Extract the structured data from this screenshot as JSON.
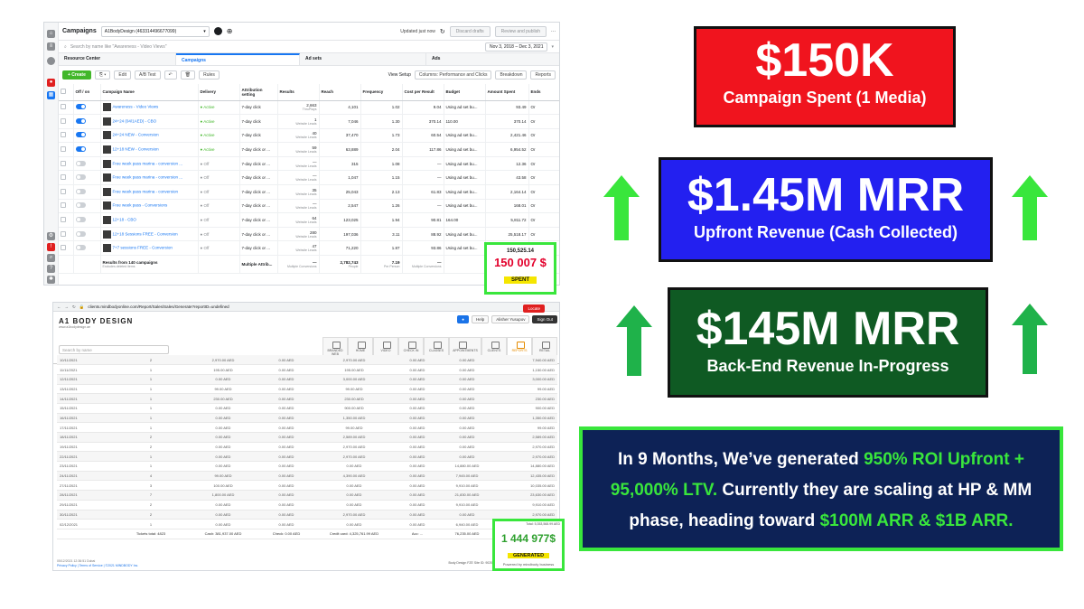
{
  "fb": {
    "title": "Campaigns",
    "account": "A1BodyDesign (463314496677099)",
    "updated": "Updated just now",
    "discard": "Discard drafts",
    "review": "Review and publish",
    "search_placeholder": "Search by name like \"Awareness - Video Views\"",
    "date_range": "Nov 3, 2018 – Dec 3, 2021",
    "tabs": [
      "Resource Center",
      "Campaigns",
      "Ad sets",
      "Ads"
    ],
    "create": "+ Create",
    "edit": "Edit",
    "abtest": "A/B Test",
    "rules": "Rules",
    "view_setup": "View Setup",
    "columns": "Columns: Performance and Clicks",
    "breakdown": "Breakdown",
    "reports": "Reports",
    "headers": [
      "Off / on",
      "Campaign Name",
      "Delivery",
      "Attribution setting",
      "Results",
      "Reach",
      "Frequency",
      "Cost per Result",
      "Budget",
      "Amount Spent",
      "Ends"
    ],
    "rows": [
      {
        "on": true,
        "name": "Awareness - Video Views",
        "delivery": "Active",
        "attr": "7-day click",
        "results": "2,663",
        "rsub": "ThruPlays",
        "reach": "4,101",
        "freq": "1.02",
        "cpr": "9.04",
        "budget": "Using ad set bu...",
        "spent": "93.49",
        "ends": "Or"
      },
      {
        "on": true,
        "name": "24+24 (04/1AED) - CBO",
        "delivery": "Active",
        "attr": "7-day click",
        "results": "1",
        "rsub": "Website Leads",
        "reach": "7,046",
        "freq": "1.30",
        "cpr": "370.14",
        "budget": "110.00",
        "spent": "370.14",
        "ends": "Or"
      },
      {
        "on": true,
        "name": "24+24 NEW - Conversion",
        "delivery": "Active",
        "attr": "7-day click",
        "results": "40",
        "rsub": "Website Leads",
        "reach": "37,470",
        "freq": "1.73",
        "cpr": "60.54",
        "budget": "Using ad set bu...",
        "spent": "2,421.46",
        "ends": "Or"
      },
      {
        "on": true,
        "name": "12+18 NEW - Conversion",
        "delivery": "Active",
        "attr": "7-day click or ...",
        "results": "59",
        "rsub": "Website Leads",
        "reach": "63,889",
        "freq": "2.04",
        "cpr": "117.86",
        "budget": "Using ad set bu...",
        "spent": "6,954.52",
        "ends": "Or"
      },
      {
        "on": false,
        "name": "Free week pass marina - conversion ...",
        "delivery": "Off",
        "attr": "7-day click or ...",
        "results": "—",
        "rsub": "Website Leads",
        "reach": "315",
        "freq": "1.08",
        "cpr": "—",
        "budget": "Using ad set bu...",
        "spent": "12.36",
        "ends": "Or"
      },
      {
        "on": false,
        "name": "Free week pass marina - conversion ...",
        "delivery": "Off",
        "attr": "7-day click or ...",
        "results": "—",
        "rsub": "Website Leads",
        "reach": "1,047",
        "freq": "1.15",
        "cpr": "—",
        "budget": "Using ad set bu...",
        "spent": "43.58",
        "ends": "Or"
      },
      {
        "on": false,
        "name": "Free week pass marina - conversion",
        "delivery": "Off",
        "attr": "7-day click or ...",
        "results": "35",
        "rsub": "Website Leads",
        "reach": "25,043",
        "freq": "2.13",
        "cpr": "61.83",
        "budget": "Using ad set bu...",
        "spent": "2,164.14",
        "ends": "Or"
      },
      {
        "on": false,
        "name": "Free week pass - Conversions",
        "delivery": "Off",
        "attr": "7-day click or ...",
        "results": "—",
        "rsub": "Website Leads",
        "reach": "2,547",
        "freq": "1.26",
        "cpr": "—",
        "budget": "Using ad set bu...",
        "spent": "168.01",
        "ends": "Or"
      },
      {
        "on": false,
        "name": "12+18 - CBO",
        "delivery": "Off",
        "attr": "7-day click or ...",
        "results": "64",
        "rsub": "Website Leads",
        "reach": "123,025",
        "freq": "1.94",
        "cpr": "90.81",
        "budget": "164.00",
        "spent": "5,811.72",
        "ends": "Or"
      },
      {
        "on": false,
        "name": "12+18 Sessions FREE - Conversion",
        "delivery": "Off",
        "attr": "7-day click or ...",
        "results": "280",
        "rsub": "Website Leads",
        "reach": "197,036",
        "freq": "3.11",
        "cpr": "88.92",
        "budget": "Using ad set bu...",
        "spent": "25,518.17",
        "ends": "Or"
      },
      {
        "on": false,
        "name": "7+7 sessions FREE - Conversion",
        "delivery": "Off",
        "attr": "7-day click or ...",
        "results": "47",
        "rsub": "Website Leads",
        "reach": "71,220",
        "freq": "1.87",
        "cpr": "93.86",
        "budget": "Using ad set bu...",
        "spent": "4,412.16",
        "ends": "Or"
      }
    ],
    "total": {
      "name": "Results from 140 campaigns",
      "sub": "Excludes deleted items",
      "attr": "Multiple Attrib...",
      "results": "—",
      "rsub": "Multiple Conversions",
      "reach": "2,782,743",
      "reachsub": "People",
      "freq": "7.19",
      "freqsub": "Per Person",
      "cpr": "—",
      "cprsub": "Multiple Conversions",
      "spent": "150,525.14"
    },
    "spent_label": "150 007 $",
    "spent_tag": "SPENT"
  },
  "mb": {
    "url": "clients.mindbodyonline.com/Report/Sales/Sales/Generate?reportID=undefined",
    "brand": "A1 BODY DESIGN",
    "brand_sub": "www.a1bodydesign.ae",
    "help": "Help",
    "user": "Alisher Yusupov",
    "signout": "Sign Out",
    "locate": "Locate",
    "search_placeholder": "Search by name",
    "nav": [
      "BRANDED WEB",
      "HOME",
      "VIDEO",
      "CHECK IN",
      "CLASSES",
      "APPOINTMENTS",
      "CLIENTS",
      "REPORTS",
      "RETAIL"
    ],
    "rows": [
      [
        "10/11/2021",
        "2",
        "2,970.00 AED",
        "0.00 AED",
        "2,970.00 AED",
        "0.00 AED",
        "0.00 AED",
        "7,940.00 AED"
      ],
      [
        "11/11/2021",
        "1",
        "195.00 AED",
        "0.00 AED",
        "195.00 AED",
        "0.00 AED",
        "0.00 AED",
        "1,150.00 AED"
      ],
      [
        "12/11/2021",
        "1",
        "0.00 AED",
        "0.00 AED",
        "3,000.00 AED",
        "0.00 AED",
        "0.00 AED",
        "3,000.00 AED"
      ],
      [
        "13/11/2021",
        "1",
        "99.00 AED",
        "0.00 AED",
        "99.00 AED",
        "0.00 AED",
        "0.00 AED",
        "99.00 AED"
      ],
      [
        "14/11/2021",
        "1",
        "230.00 AED",
        "0.00 AED",
        "230.00 AED",
        "0.00 AED",
        "0.00 AED",
        "230.00 AED"
      ],
      [
        "15/11/2021",
        "1",
        "0.00 AED",
        "0.00 AED",
        "900.00 AED",
        "0.00 AED",
        "0.00 AED",
        "900.00 AED"
      ],
      [
        "16/11/2021",
        "1",
        "0.00 AED",
        "0.00 AED",
        "1,350.00 AED",
        "0.00 AED",
        "0.00 AED",
        "1,350.00 AED"
      ],
      [
        "17/11/2021",
        "1",
        "0.00 AED",
        "0.00 AED",
        "99.00 AED",
        "0.00 AED",
        "0.00 AED",
        "99.00 AED"
      ],
      [
        "18/11/2021",
        "2",
        "0.00 AED",
        "0.00 AED",
        "2,589.00 AED",
        "0.00 AED",
        "0.00 AED",
        "2,589.00 AED"
      ],
      [
        "19/11/2021",
        "2",
        "0.00 AED",
        "0.00 AED",
        "2,970.00 AED",
        "0.00 AED",
        "0.00 AED",
        "2,970.00 AED"
      ],
      [
        "22/11/2021",
        "1",
        "0.00 AED",
        "0.00 AED",
        "2,970.00 AED",
        "0.00 AED",
        "0.00 AED",
        "2,970.00 AED"
      ],
      [
        "23/11/2021",
        "1",
        "0.00 AED",
        "0.00 AED",
        "0.00 AED",
        "0.00 AED",
        "14,880.00 AED",
        "14,880.00 AED"
      ],
      [
        "24/11/2021",
        "4",
        "99.00 AED",
        "0.00 AED",
        "4,390.00 AED",
        "0.00 AED",
        "7,945.00 AED",
        "12,435.00 AED"
      ],
      [
        "27/11/2021",
        "3",
        "100.00 AED",
        "0.00 AED",
        "0.00 AED",
        "0.00 AED",
        "9,910.00 AED",
        "10,035.00 AED"
      ],
      [
        "28/11/2021",
        "7",
        "1,800.00 AED",
        "0.00 AED",
        "0.00 AED",
        "0.00 AED",
        "21,830.00 AED",
        "23,630.00 AED"
      ],
      [
        "29/11/2021",
        "2",
        "0.00 AED",
        "0.00 AED",
        "0.00 AED",
        "0.00 AED",
        "9,910.00 AED",
        "9,910.00 AED"
      ],
      [
        "30/11/2021",
        "2",
        "0.00 AED",
        "0.00 AED",
        "2,970.00 AED",
        "0.00 AED",
        "0.00 AED",
        "2,970.00 AED"
      ],
      [
        "02/12/2021",
        "1",
        "0.00 AED",
        "0.00 AED",
        "0.00 AED",
        "0.00 AED",
        "6,940.00 AED",
        "6,940.00 AED"
      ]
    ],
    "totals": [
      "",
      "Tickets total: 4823",
      "Cash: 381,937.00 AED",
      "Check: 0.00 AED",
      "Credit card: 4,325,761.99 AED",
      "Acc: ...",
      "76,235.00 AED",
      "Total: 5,353,568.99 AED"
    ],
    "foot1": "05/12/2021 12:36:51 Dubai",
    "foot2": "Privacy Policy | Terms of Service | ©2021 MINDBODY Inc.",
    "foot_right": "Body Design FZE  Site ID: 902024",
    "gen_total": "Total: 5,353,568.99 AED",
    "gen_value": "1 444 977$",
    "gen_tag": "GENERATED",
    "gen_powered": "Powered by  mindbody business"
  },
  "boxes": {
    "b1_big": "$150K",
    "b1_small": "Campaign Spent (1 Media)",
    "b2_big": "$1.45M MRR",
    "b2_small": "Upfront Revenue (Cash Collected)",
    "b3_big": "$145M MRR",
    "b3_small": "Back-End Revenue In-Progress"
  },
  "summary": {
    "p1": "In 9 Months, We’ve generated ",
    "h1": "950% ROI Upfront + 95,000% LTV.",
    "p2": " Currently they are scaling at HP & MM phase, heading toward ",
    "h2": "$100M ARR & $1B ARR."
  },
  "colors": {
    "red": "#f0141e",
    "blue": "#2320f0",
    "green_dark": "#0f5a23",
    "navy": "#0d2256",
    "neon_green": "#39e63c"
  }
}
